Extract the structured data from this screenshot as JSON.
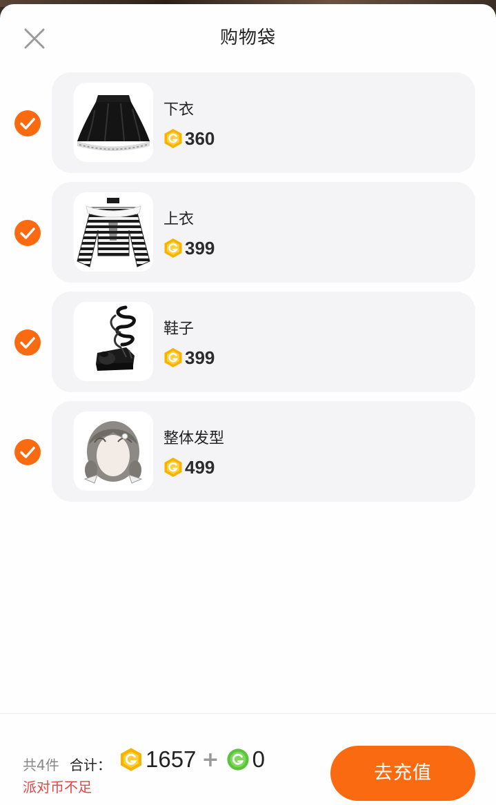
{
  "header": {
    "title": "购物袋",
    "close_icon": "close-icon"
  },
  "items": [
    {
      "name": "下衣",
      "price": "360",
      "checked": true,
      "image": "black-skirt"
    },
    {
      "name": "上衣",
      "price": "399",
      "checked": true,
      "image": "striped-top"
    },
    {
      "name": "鞋子",
      "price": "399",
      "checked": true,
      "image": "ribbon-platform-shoes"
    },
    {
      "name": "整体发型",
      "price": "499",
      "checked": true,
      "image": "braided-hairstyle"
    }
  ],
  "footer": {
    "count": "共4件",
    "sum_label": "合计：",
    "gold_total": "1657",
    "plus": "+",
    "green_total": "0",
    "warning": "派对币不足",
    "recharge_label": "去充值"
  },
  "colors": {
    "accent": "#fa6a10",
    "warning": "#e64545",
    "card_bg": "#f4f3f6",
    "gold_coin": "#f4b400",
    "green_coin": "#5cc43c"
  }
}
